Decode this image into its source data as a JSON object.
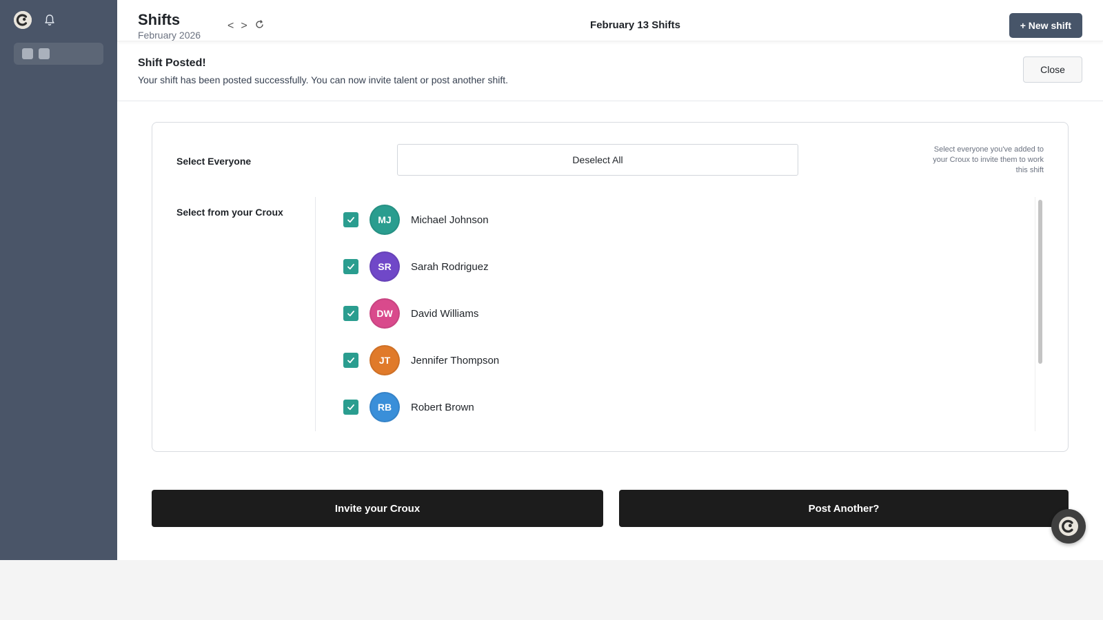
{
  "header": {
    "title": "Shifts",
    "subtitle": "February 2026",
    "nav_prev": "<",
    "nav_next": ">",
    "center_title": "February 13 Shifts",
    "new_shift_label": "+ New shift"
  },
  "banner": {
    "title": "Shift Posted!",
    "message": "Your shift has been posted successfully. You can now invite talent or post another shift.",
    "close_label": "Close"
  },
  "invite": {
    "select_everyone_label": "Select Everyone",
    "deselect_label": "Deselect All",
    "hint": "Select everyone you've added to your Croux to invite them to work this shift",
    "select_from_label": "Select from your Croux",
    "members": [
      {
        "initials": "MJ",
        "name": "Michael Johnson",
        "color": "#2a9d8f",
        "checked": true
      },
      {
        "initials": "SR",
        "name": "Sarah Rodriguez",
        "color": "#7048c8",
        "checked": true
      },
      {
        "initials": "DW",
        "name": "David Williams",
        "color": "#d94a8c",
        "checked": true
      },
      {
        "initials": "JT",
        "name": "Jennifer Thompson",
        "color": "#e07a2a",
        "checked": true
      },
      {
        "initials": "RB",
        "name": "Robert Brown",
        "color": "#3a8fd9",
        "checked": true
      }
    ]
  },
  "actions": {
    "invite_label": "Invite your Croux",
    "post_another_label": "Post Another?"
  },
  "colors": {
    "sidebar": "#4a5568",
    "primary": "#475569",
    "check": "#2a9d8f",
    "dark_button": "#1c1c1c"
  }
}
